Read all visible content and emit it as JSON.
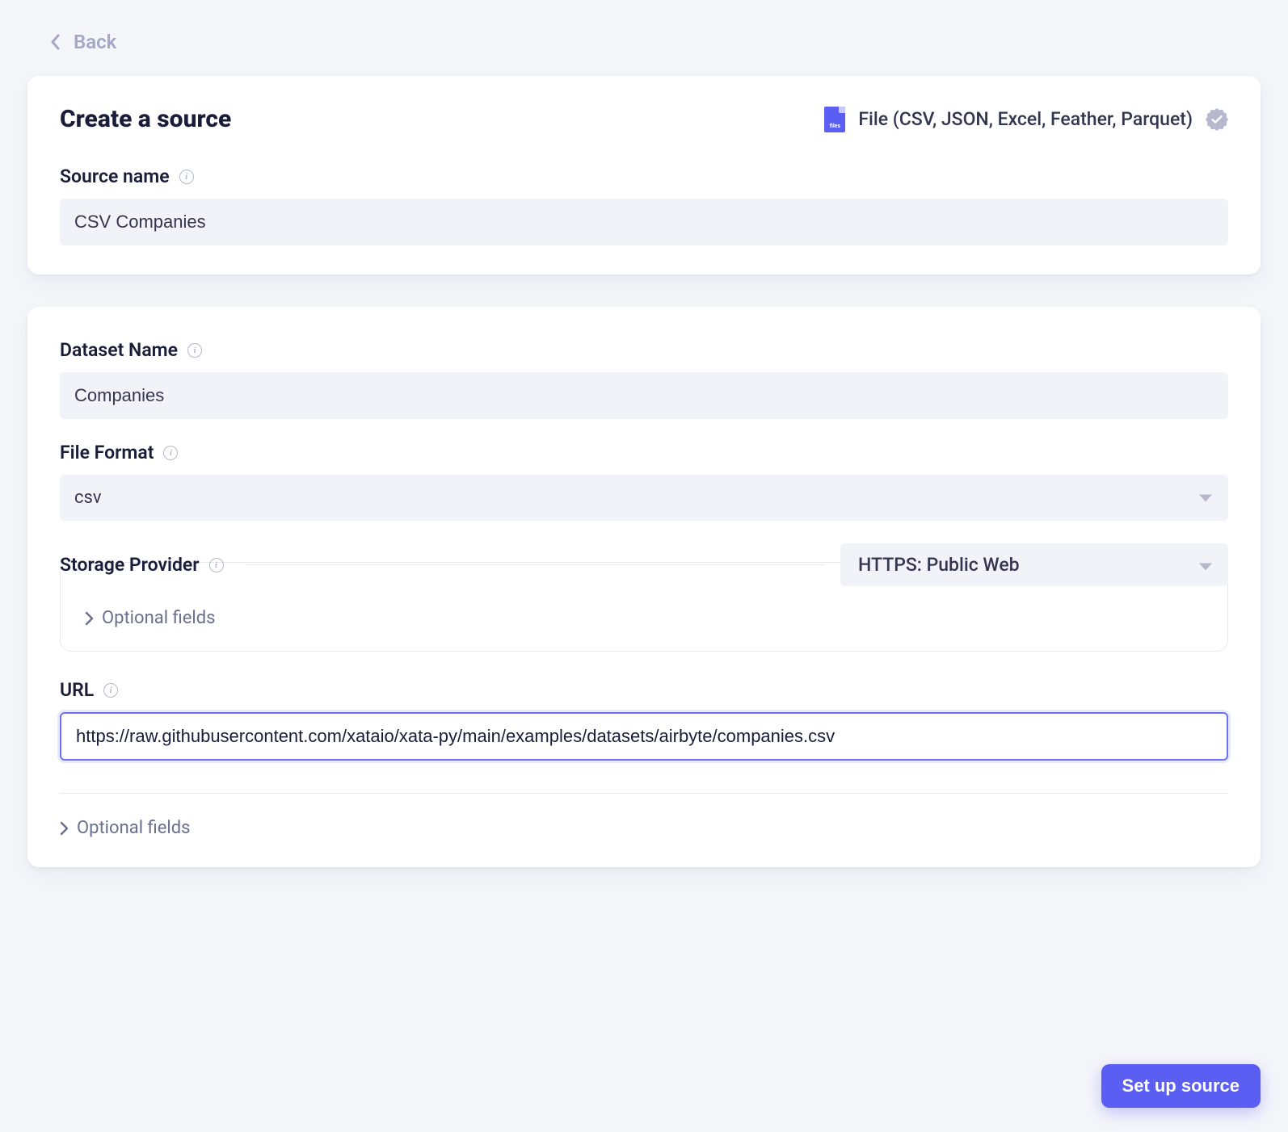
{
  "nav": {
    "back_label": "Back"
  },
  "header": {
    "title": "Create a source",
    "source_type_label": "File (CSV, JSON, Excel, Feather, Parquet)",
    "file_icon_text": "files"
  },
  "fields": {
    "source_name": {
      "label": "Source name",
      "value": "CSV Companies"
    },
    "dataset_name": {
      "label": "Dataset Name",
      "value": "Companies"
    },
    "file_format": {
      "label": "File Format",
      "value": "csv"
    },
    "storage_provider": {
      "label": "Storage Provider",
      "value": "HTTPS: Public Web",
      "optional_label": "Optional fields"
    },
    "url": {
      "label": "URL",
      "value": "https://raw.githubusercontent.com/xataio/xata-py/main/examples/datasets/airbyte/companies.csv"
    }
  },
  "footer": {
    "optional_label": "Optional fields",
    "setup_button_label": "Set up source"
  }
}
